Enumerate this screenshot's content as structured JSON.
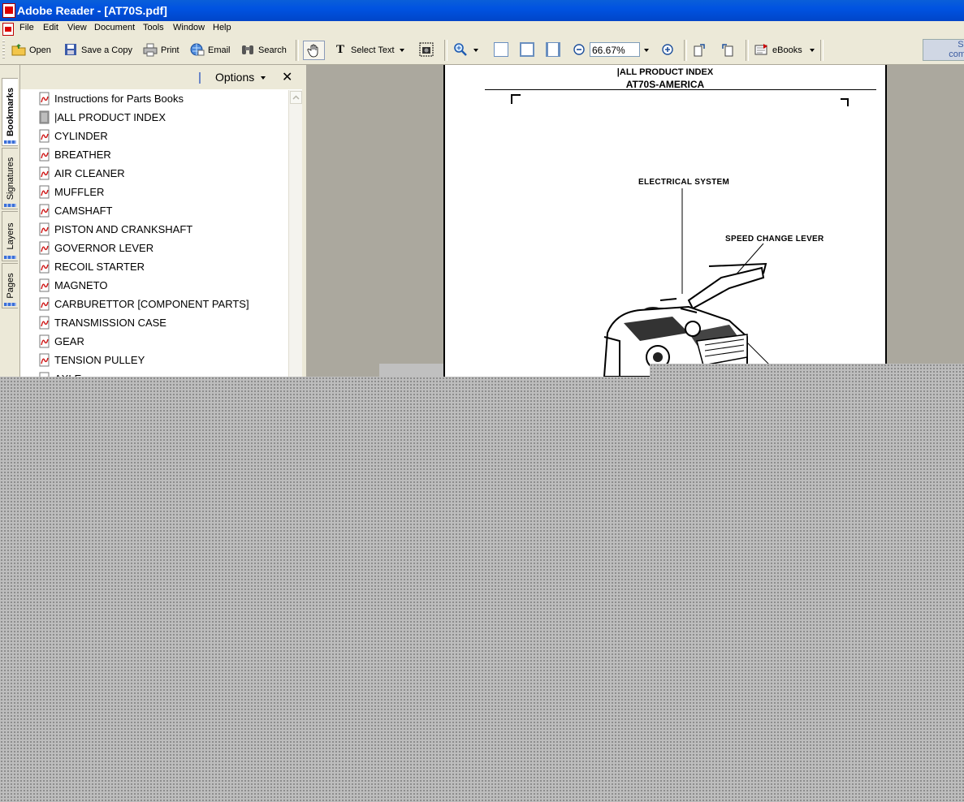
{
  "window": {
    "title": "Adobe Reader - [AT70S.pdf]"
  },
  "menu": [
    "File",
    "Edit",
    "View",
    "Document",
    "Tools",
    "Window",
    "Help"
  ],
  "toolbar": {
    "open": "Open",
    "save_copy": "Save a Copy",
    "print": "Print",
    "email": "Email",
    "search": "Search",
    "select_text": "Select Text",
    "zoom": "66.67%",
    "ebooks": "eBooks",
    "promo": "Si\ncom"
  },
  "side_tabs": [
    "Bookmarks",
    "Signatures",
    "Layers",
    "Pages"
  ],
  "panel": {
    "options": "Options",
    "close": "✕",
    "bookmarks": [
      "Instructions for Parts Books",
      "|ALL PRODUCT INDEX",
      "CYLINDER",
      "BREATHER",
      "AIR CLEANER",
      "MUFFLER",
      "CAMSHAFT",
      "PISTON AND CRANKSHAFT",
      "GOVERNOR LEVER",
      "RECOIL STARTER",
      "MAGNETO",
      "CARBURETTOR [COMPONENT PARTS]",
      "TRANSMISSION CASE",
      "GEAR",
      "TENSION PULLEY",
      "AXLE"
    ]
  },
  "document": {
    "header1": "|ALL PRODUCT INDEX",
    "header2": "AT70S-AMERICA",
    "label_electrical": "ELECTRICAL SYSTEM",
    "label_speed": "SPEED CHANGE LEVER"
  }
}
